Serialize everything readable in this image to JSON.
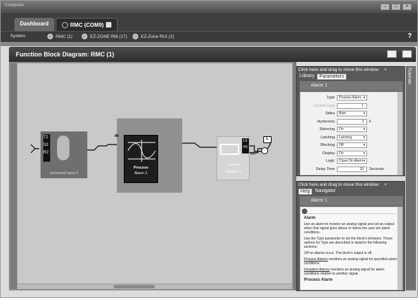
{
  "window": {
    "title": "Composer"
  },
  "tabs": {
    "dashboard": "Dashboard",
    "rmc": "RMC (COM9)"
  },
  "nav": {
    "system": "System",
    "items": [
      "RMC (1)",
      "EZ-ZONE RM (17)",
      "EZ-Zone RUI (2)"
    ],
    "help": "?"
  },
  "header": {
    "title": "Function Block Diagram: RMC (1)"
  },
  "diagram": {
    "input": {
      "pins": [
        "T2",
        "S2",
        "R2"
      ],
      "caption": "Universal Input 2"
    },
    "alarm": {
      "pin": "IN",
      "name": "Process",
      "instance": "Alarm 1"
    },
    "output": {
      "pins": [
        "L5",
        "K5",
        "NO"
      ],
      "name": "Form A",
      "instance": "Output 5",
      "load": "L"
    }
  },
  "library_panel": {
    "drag_hint": "Click here and drag to move this window",
    "tabs": [
      "Library",
      "Parameters"
    ],
    "active_tab": "Parameters",
    "section": "Alarm 1",
    "rows": [
      {
        "label": "Type",
        "value": "Process Alarm",
        "kind": "dropdown"
      },
      {
        "label": "Control Loop",
        "value": "1",
        "kind": "number",
        "dim": true
      },
      {
        "label": "Sides",
        "value": "Both",
        "kind": "dropdown"
      },
      {
        "label": "Hysteresis",
        "value": "3",
        "kind": "number",
        "unit": "F"
      },
      {
        "label": "Silencing",
        "value": "On",
        "kind": "dropdown"
      },
      {
        "label": "Latching",
        "value": "Latching",
        "kind": "dropdown"
      },
      {
        "label": "Blocking",
        "value": "Off",
        "kind": "dropdown"
      },
      {
        "label": "Display",
        "value": "On",
        "kind": "dropdown"
      },
      {
        "label": "Logic",
        "value": "Close On Alarm",
        "kind": "dropdown"
      },
      {
        "label": "Delay Time",
        "value": "10",
        "kind": "number",
        "unit": "Seconds"
      }
    ]
  },
  "help_panel": {
    "drag_hint": "Click here and drag to move this window",
    "tabs": [
      "Help",
      "Navigator"
    ],
    "active_tab": "Help",
    "section": "Alarm 1",
    "heading": "Alarm",
    "paragraphs": [
      "Use an alarm to monitor an analog signal and set an output when that signal goes above or below the user-set alarm conditions.",
      "Use the Type parameter to set the block's behavior. These options for Type are described in detail in the following sections:"
    ],
    "off_term": "Off",
    "off_text": " no alarms occur. The block's output is off.",
    "process_term": "Process Alarms",
    "process_text": " monitors an analog signal for specified alarm conditions.",
    "deviation_term": "Deviation Alarms",
    "deviation_text": " monitors an analog signal for alarm conditions relative to another signal.",
    "tail": "Process Alarm"
  },
  "side_tab": "Tutorials"
}
